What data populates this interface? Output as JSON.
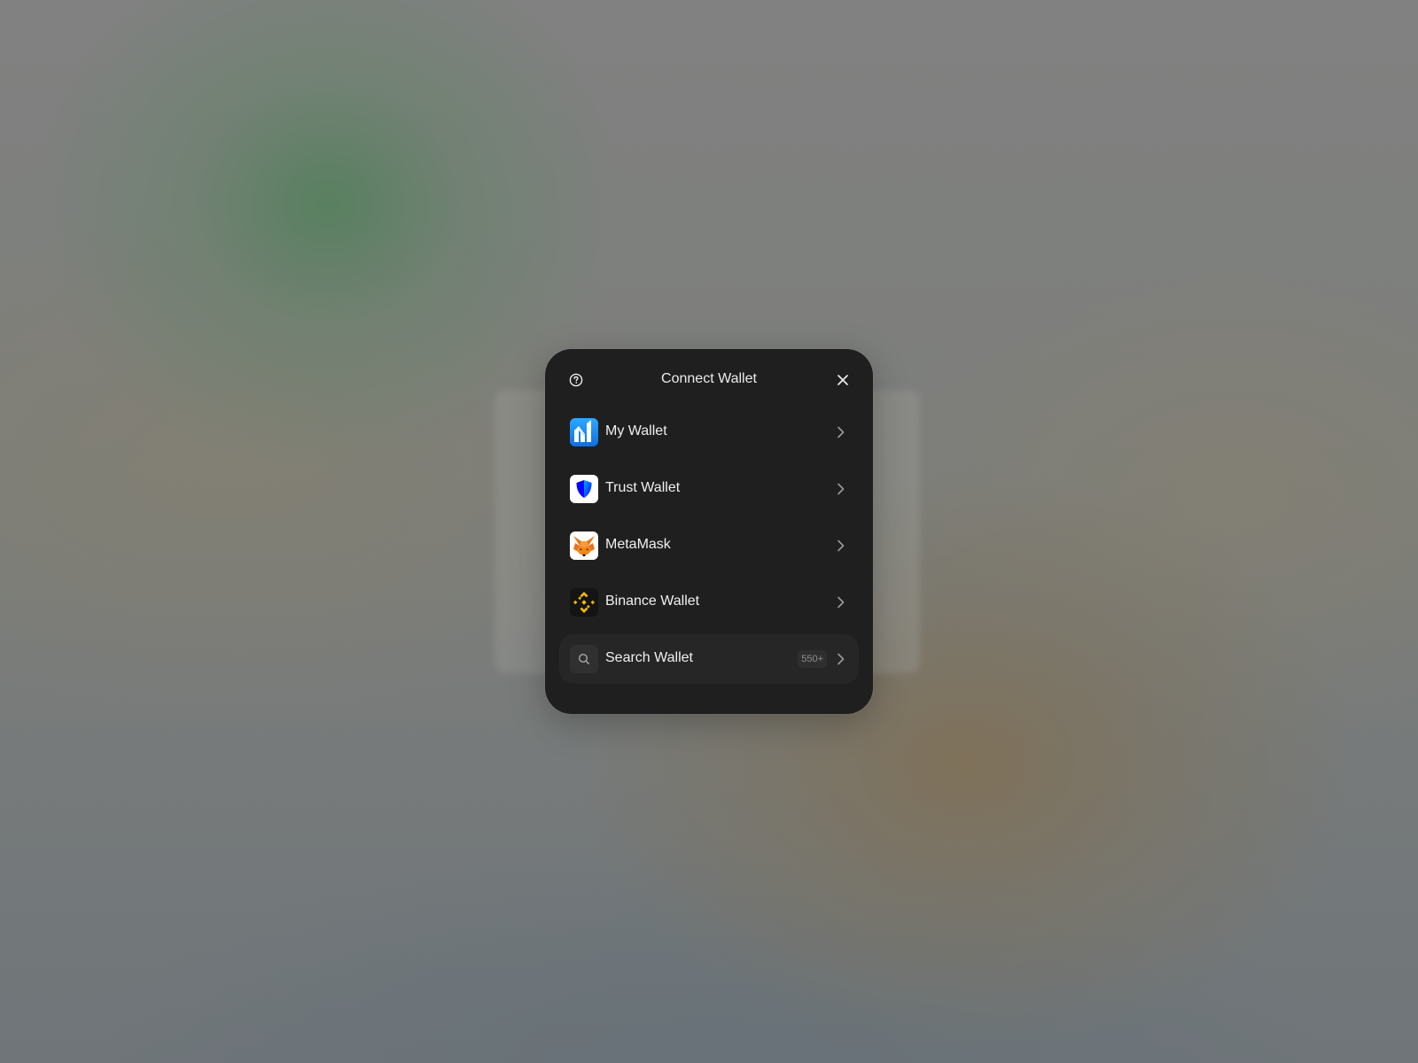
{
  "modal": {
    "title": "Connect Wallet",
    "help_icon": "question-circle-icon",
    "close_icon": "close-icon"
  },
  "wallets": [
    {
      "label": "My Wallet",
      "icon": "my-wallet-logo-icon"
    },
    {
      "label": "Trust Wallet",
      "icon": "trust-wallet-shield-icon"
    },
    {
      "label": "MetaMask",
      "icon": "metamask-fox-icon"
    },
    {
      "label": "Binance Wallet",
      "icon": "binance-logo-icon"
    }
  ],
  "search": {
    "label": "Search Wallet",
    "count": "550+",
    "icon": "search-icon"
  },
  "colors": {
    "modal_bg": "#1f1f1f",
    "search_row_bg": "#262626",
    "text": "#f0f0f0",
    "my_wallet_blue": "#1d8ff0",
    "trust_blue": "#0500ff",
    "metamask_orange": "#e2761b",
    "binance_yellow": "#f0b90b"
  }
}
